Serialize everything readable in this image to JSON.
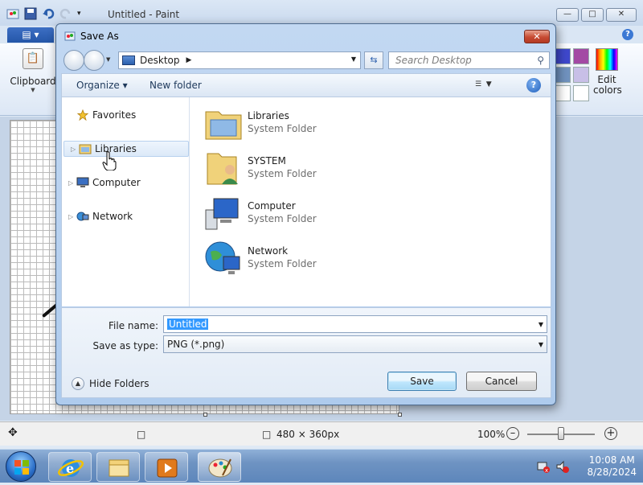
{
  "paint": {
    "title": "Untitled - Paint",
    "menu_button": "▤ ▾",
    "clipboard_label": "Clipboard",
    "edit_colors_label": "Edit colors",
    "status": {
      "canvas_size": "480 × 360px",
      "zoom": "100%"
    }
  },
  "dialog": {
    "title": "Save As",
    "address": {
      "location": "Desktop"
    },
    "search_placeholder": "Search Desktop",
    "toolbar": {
      "organize": "Organize ▾",
      "new_folder": "New folder"
    },
    "nav_pane": {
      "items": [
        {
          "label": "Favorites"
        },
        {
          "label": "Libraries"
        },
        {
          "label": "Computer"
        },
        {
          "label": "Network"
        }
      ]
    },
    "files": [
      {
        "name": "Libraries",
        "type": "System Folder"
      },
      {
        "name": "SYSTEM",
        "type": "System Folder"
      },
      {
        "name": "Computer",
        "type": "System Folder"
      },
      {
        "name": "Network",
        "type": "System Folder"
      }
    ],
    "file_name_label": "File name:",
    "file_name_value": "Untitled",
    "save_as_type_label": "Save as type:",
    "save_as_type_value": "PNG (*.png)",
    "hide_folders": "Hide Folders",
    "save_button": "Save",
    "cancel_button": "Cancel"
  },
  "taskbar": {
    "time": "10:08 AM",
    "date": "8/28/2024"
  },
  "colors": {
    "swatches": [
      "#3f48cc",
      "#a349a4",
      "#7092be",
      "#c8bfe7",
      "#ffffff",
      "#ffffff"
    ]
  }
}
